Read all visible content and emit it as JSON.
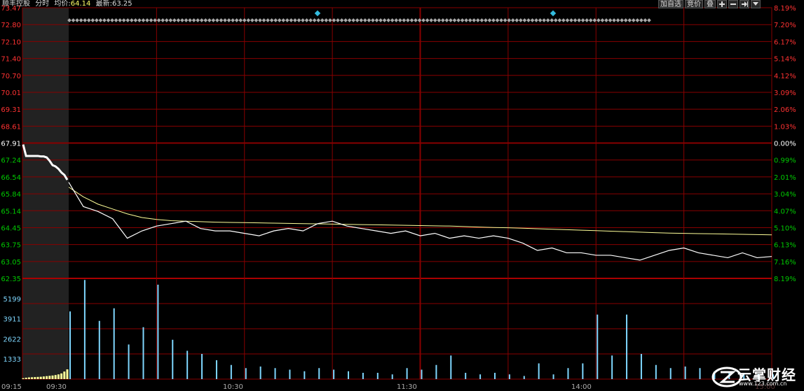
{
  "header": {
    "stock_name": "顺丰控股",
    "mode": "分时",
    "avg_label": "均价:",
    "avg_value": "64.14",
    "last_label": "最新:",
    "last_value": "63.25"
  },
  "toolbar": {
    "add_watch_label": "加自选",
    "auction_label": "竞价",
    "plate_label": "叠"
  },
  "logo": {
    "text": "云掌财经",
    "url": "www.123.com.cn"
  },
  "colors": {
    "up": "#ff3232",
    "down": "#00c800",
    "neutral": "#ffffff",
    "grid": "#880000",
    "price_line": "#ffffff",
    "avg_line": "#ffff99",
    "volume": "#7fd7ff",
    "auction": "#ffff99"
  },
  "chart_data": {
    "type": "line",
    "price_ticks": [
      "73.47",
      "72.80",
      "72.10",
      "71.40",
      "70.70",
      "70.01",
      "69.31",
      "68.61",
      "67.91",
      "67.24",
      "66.54",
      "65.84",
      "65.14",
      "64.45",
      "63.75",
      "63.05",
      "62.35"
    ],
    "pct_ticks": [
      "8.19%",
      "7.20%",
      "6.17%",
      "5.14%",
      "4.12%",
      "3.09%",
      "2.06%",
      "1.03%",
      "0.00%",
      "0.99%",
      "2.01%",
      "3.04%",
      "4.07%",
      "5.10%",
      "6.13%",
      "7.16%",
      "8.19%"
    ],
    "volume_ticks": [
      "5199",
      "3911",
      "2622",
      "1333"
    ],
    "time_labels": [
      "09:15",
      "09:30",
      "10:30",
      "11:30",
      "14:00",
      "15:00"
    ],
    "prev_close": 67.91,
    "price_range": [
      62.35,
      73.47
    ],
    "auction": {
      "x": [
        0,
        1,
        2,
        3,
        4,
        5,
        6,
        7,
        8,
        9,
        10,
        11,
        12,
        13,
        14,
        15
      ],
      "price": [
        67.85,
        67.38,
        67.38,
        67.38,
        67.38,
        67.38,
        67.36,
        67.36,
        67.32,
        67.18,
        67.0,
        66.95,
        66.85,
        66.7,
        66.6,
        66.4
      ],
      "volume": [
        60,
        90,
        110,
        120,
        130,
        140,
        150,
        170,
        190,
        210,
        230,
        260,
        300,
        360,
        480,
        620
      ]
    },
    "minutes": [
      0,
      5,
      10,
      15,
      20,
      25,
      30,
      35,
      40,
      45,
      50,
      55,
      60,
      65,
      70,
      75,
      80,
      85,
      90,
      95,
      100,
      105,
      110,
      115,
      120,
      125,
      130,
      135,
      140,
      145,
      150,
      155,
      160,
      165,
      170,
      175,
      180,
      185,
      190,
      195,
      200,
      205,
      210,
      215,
      220,
      225,
      230,
      235,
      240
    ],
    "price": [
      66.3,
      65.3,
      65.1,
      64.8,
      64.0,
      64.3,
      64.5,
      64.6,
      64.7,
      64.4,
      64.3,
      64.3,
      64.2,
      64.1,
      64.3,
      64.4,
      64.3,
      64.6,
      64.7,
      64.5,
      64.4,
      64.3,
      64.2,
      64.3,
      64.1,
      64.2,
      64.0,
      64.1,
      64.0,
      64.1,
      64.0,
      63.8,
      63.5,
      63.6,
      63.4,
      63.4,
      63.3,
      63.3,
      63.2,
      63.1,
      63.3,
      63.5,
      63.6,
      63.4,
      63.3,
      63.2,
      63.4,
      63.2,
      63.25
    ],
    "avg_price": [
      66.1,
      65.7,
      65.4,
      65.2,
      65.0,
      64.85,
      64.77,
      64.72,
      64.7,
      64.68,
      64.66,
      64.65,
      64.64,
      64.63,
      64.62,
      64.61,
      64.6,
      64.59,
      64.58,
      64.57,
      64.56,
      64.55,
      64.54,
      64.53,
      64.52,
      64.51,
      64.5,
      64.48,
      64.46,
      64.44,
      64.43,
      64.41,
      64.39,
      64.37,
      64.35,
      64.33,
      64.31,
      64.29,
      64.27,
      64.25,
      64.23,
      64.21,
      64.2,
      64.19,
      64.18,
      64.17,
      64.16,
      64.15,
      64.14
    ],
    "volume": [
      4300,
      6300,
      3700,
      4500,
      2200,
      3300,
      6000,
      2500,
      1800,
      1600,
      1200,
      900,
      700,
      800,
      700,
      600,
      500,
      700,
      600,
      500,
      400,
      400,
      300,
      700,
      600,
      900,
      1500,
      400,
      300,
      400,
      300,
      200,
      1000,
      300,
      700,
      1000,
      4100,
      1500,
      4100,
      1600,
      900,
      700,
      800,
      700,
      500,
      400,
      400,
      350,
      300
    ],
    "volume_max": 6400
  }
}
